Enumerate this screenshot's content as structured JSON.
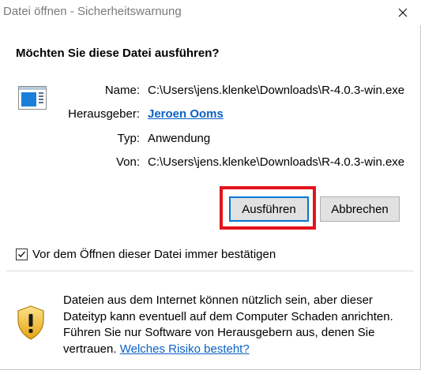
{
  "window": {
    "title": "Datei öffnen - Sicherheitswarnung"
  },
  "dialog": {
    "question": "Möchten Sie diese Datei ausführen?",
    "app_icon": "application-window-icon",
    "fields": {
      "name_label": "Name:",
      "name_value": "C:\\Users\\jens.klenke\\Downloads\\R-4.0.3-win.exe",
      "publisher_label": "Herausgeber:",
      "publisher_value": "Jeroen Ooms",
      "type_label": "Typ:",
      "type_value": "Anwendung",
      "from_label": "Von:",
      "from_value": "C:\\Users\\jens.klenke\\Downloads\\R-4.0.3-win.exe"
    },
    "buttons": {
      "run_label": "Ausführen",
      "cancel_label": "Abbrechen"
    },
    "highlight_color": "#e3131b",
    "checkbox": {
      "label": "Vor dem Öffnen dieser Datei immer bestätigen",
      "checked": true
    },
    "warning": {
      "icon": "security-shield-warning-icon",
      "line1": "Dateien aus dem Internet können nützlich sein, aber dieser",
      "line2": "Dateityp kann eventuell auf dem Computer Schaden anrichten.",
      "line3": "Führen Sie nur Software von Herausgebern aus, denen Sie",
      "line4_text": "vertrauen.",
      "line4_link": "Welches Risiko besteht?"
    },
    "colors": {
      "link": "#0b61c4",
      "focus_border": "#0078d7"
    }
  }
}
